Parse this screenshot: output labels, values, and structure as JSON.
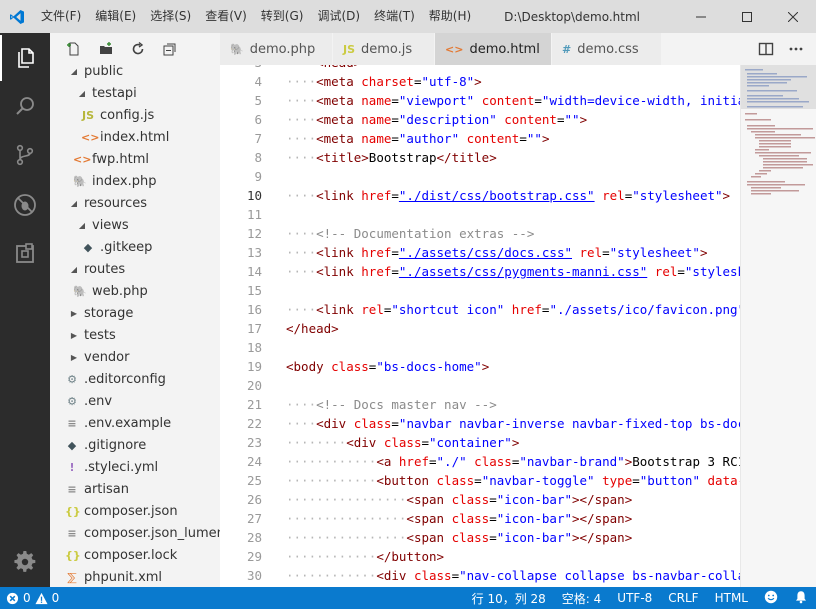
{
  "titlebar": {
    "menu": [
      "文件(F)",
      "编辑(E)",
      "选择(S)",
      "查看(V)",
      "转到(G)",
      "调试(D)",
      "终端(T)",
      "帮助(H)"
    ],
    "title": "D:\\Desktop\\demo.html",
    "logo_color": "#0078d4"
  },
  "sidebar": {
    "tree": [
      {
        "label": "public",
        "type": "folder-open",
        "depth": 1
      },
      {
        "label": "testapi",
        "type": "folder-open",
        "depth": 2
      },
      {
        "label": "config.js",
        "type": "js",
        "depth": 3
      },
      {
        "label": "index.html",
        "type": "html",
        "depth": 3
      },
      {
        "label": "fwp.html",
        "type": "html",
        "depth": 2
      },
      {
        "label": "index.php",
        "type": "php",
        "depth": 2
      },
      {
        "label": "resources",
        "type": "folder-open",
        "depth": 1
      },
      {
        "label": "views",
        "type": "folder-open",
        "depth": 2
      },
      {
        "label": ".gitkeep",
        "type": "git",
        "depth": 3
      },
      {
        "label": "routes",
        "type": "folder-open",
        "depth": 1
      },
      {
        "label": "web.php",
        "type": "php",
        "depth": 2
      },
      {
        "label": "storage",
        "type": "folder-closed",
        "depth": 1
      },
      {
        "label": "tests",
        "type": "folder-closed",
        "depth": 1
      },
      {
        "label": "vendor",
        "type": "folder-closed",
        "depth": 1
      },
      {
        "label": ".editorconfig",
        "type": "gear",
        "depth": 1
      },
      {
        "label": ".env",
        "type": "gear",
        "depth": 1
      },
      {
        "label": ".env.example",
        "type": "text",
        "depth": 1
      },
      {
        "label": ".gitignore",
        "type": "git",
        "depth": 1
      },
      {
        "label": ".styleci.yml",
        "type": "yml",
        "depth": 1
      },
      {
        "label": "artisan",
        "type": "text",
        "depth": 1
      },
      {
        "label": "composer.json",
        "type": "json",
        "depth": 1
      },
      {
        "label": "composer.json_lumen...",
        "type": "text",
        "depth": 1
      },
      {
        "label": "composer.lock",
        "type": "json",
        "depth": 1
      },
      {
        "label": "phpunit.xml",
        "type": "xml",
        "depth": 1
      }
    ]
  },
  "tabs": [
    {
      "label": "demo.php",
      "icon": "php-icon",
      "active": false
    },
    {
      "label": "demo.js",
      "icon": "js-icon",
      "active": false
    },
    {
      "label": "demo.html",
      "icon": "html-icon",
      "active": true
    },
    {
      "label": "demo.css",
      "icon": "css-icon",
      "active": false
    }
  ],
  "editor": {
    "current_line": "10",
    "lines": [
      {
        "n": "3",
        "tokens": [
          [
            "ws",
            "····"
          ],
          [
            "tag",
            "<head>"
          ]
        ]
      },
      {
        "n": "4",
        "tokens": [
          [
            "ws",
            "····"
          ],
          [
            "tag",
            "<meta "
          ],
          [
            "attr",
            "charset"
          ],
          [
            "text",
            "="
          ],
          [
            "str",
            "\"utf-8\""
          ],
          [
            "tag",
            ">"
          ]
        ]
      },
      {
        "n": "5",
        "tokens": [
          [
            "ws",
            "····"
          ],
          [
            "tag",
            "<meta "
          ],
          [
            "attr",
            "name"
          ],
          [
            "text",
            "="
          ],
          [
            "str",
            "\"viewport\""
          ],
          [
            "text",
            " "
          ],
          [
            "attr",
            "content"
          ],
          [
            "text",
            "="
          ],
          [
            "str",
            "\"width=device-width, initial-sc"
          ]
        ]
      },
      {
        "n": "6",
        "tokens": [
          [
            "ws",
            "····"
          ],
          [
            "tag",
            "<meta "
          ],
          [
            "attr",
            "name"
          ],
          [
            "text",
            "="
          ],
          [
            "str",
            "\"description\""
          ],
          [
            "text",
            " "
          ],
          [
            "attr",
            "content"
          ],
          [
            "text",
            "="
          ],
          [
            "str",
            "\"\""
          ],
          [
            "tag",
            ">"
          ]
        ]
      },
      {
        "n": "7",
        "tokens": [
          [
            "ws",
            "····"
          ],
          [
            "tag",
            "<meta "
          ],
          [
            "attr",
            "name"
          ],
          [
            "text",
            "="
          ],
          [
            "str",
            "\"author\""
          ],
          [
            "text",
            " "
          ],
          [
            "attr",
            "content"
          ],
          [
            "text",
            "="
          ],
          [
            "str",
            "\"\""
          ],
          [
            "tag",
            ">"
          ]
        ]
      },
      {
        "n": "8",
        "tokens": [
          [
            "ws",
            "····"
          ],
          [
            "tag",
            "<title>"
          ],
          [
            "text",
            "Bootstrap"
          ],
          [
            "tag",
            "</title>"
          ]
        ]
      },
      {
        "n": "9",
        "tokens": []
      },
      {
        "n": "10",
        "tokens": [
          [
            "ws",
            "····"
          ],
          [
            "tag",
            "<link "
          ],
          [
            "attr",
            "href"
          ],
          [
            "text",
            "="
          ],
          [
            "link",
            "\"./dist/css/bootstrap.css\""
          ],
          [
            "text",
            " "
          ],
          [
            "attr",
            "rel"
          ],
          [
            "text",
            "="
          ],
          [
            "str",
            "\"stylesheet\""
          ],
          [
            "tag",
            ">"
          ]
        ]
      },
      {
        "n": "11",
        "tokens": []
      },
      {
        "n": "12",
        "tokens": [
          [
            "ws",
            "····"
          ],
          [
            "cmt",
            "<!-- Documentation extras -->"
          ]
        ]
      },
      {
        "n": "13",
        "tokens": [
          [
            "ws",
            "····"
          ],
          [
            "tag",
            "<link "
          ],
          [
            "attr",
            "href"
          ],
          [
            "text",
            "="
          ],
          [
            "link",
            "\"./assets/css/docs.css\""
          ],
          [
            "text",
            " "
          ],
          [
            "attr",
            "rel"
          ],
          [
            "text",
            "="
          ],
          [
            "str",
            "\"stylesheet\""
          ],
          [
            "tag",
            ">"
          ]
        ]
      },
      {
        "n": "14",
        "tokens": [
          [
            "ws",
            "····"
          ],
          [
            "tag",
            "<link "
          ],
          [
            "attr",
            "href"
          ],
          [
            "text",
            "="
          ],
          [
            "link",
            "\"./assets/css/pygments-manni.css\""
          ],
          [
            "text",
            " "
          ],
          [
            "attr",
            "rel"
          ],
          [
            "text",
            "="
          ],
          [
            "str",
            "\"stylesheet\""
          ]
        ]
      },
      {
        "n": "15",
        "tokens": []
      },
      {
        "n": "16",
        "tokens": [
          [
            "ws",
            "····"
          ],
          [
            "tag",
            "<link "
          ],
          [
            "attr",
            "rel"
          ],
          [
            "text",
            "="
          ],
          [
            "str",
            "\"shortcut icon\""
          ],
          [
            "text",
            " "
          ],
          [
            "attr",
            "href"
          ],
          [
            "text",
            "="
          ],
          [
            "str",
            "\"./assets/ico/favicon.png\""
          ],
          [
            "tag",
            ">"
          ]
        ]
      },
      {
        "n": "17",
        "tokens": [
          [
            "tag",
            "</head>"
          ]
        ]
      },
      {
        "n": "18",
        "tokens": []
      },
      {
        "n": "19",
        "tokens": [
          [
            "tag",
            "<body "
          ],
          [
            "attr",
            "class"
          ],
          [
            "text",
            "="
          ],
          [
            "str",
            "\"bs-docs-home\""
          ],
          [
            "tag",
            ">"
          ]
        ]
      },
      {
        "n": "20",
        "tokens": []
      },
      {
        "n": "21",
        "tokens": [
          [
            "ws",
            "····"
          ],
          [
            "cmt",
            "<!-- Docs master nav -->"
          ]
        ]
      },
      {
        "n": "22",
        "tokens": [
          [
            "ws",
            "····"
          ],
          [
            "tag",
            "<div "
          ],
          [
            "attr",
            "class"
          ],
          [
            "text",
            "="
          ],
          [
            "str",
            "\"navbar navbar-inverse navbar-fixed-top bs-docs-na"
          ]
        ]
      },
      {
        "n": "23",
        "tokens": [
          [
            "ws",
            "········"
          ],
          [
            "tag",
            "<div "
          ],
          [
            "attr",
            "class"
          ],
          [
            "text",
            "="
          ],
          [
            "str",
            "\"container\""
          ],
          [
            "tag",
            ">"
          ]
        ]
      },
      {
        "n": "24",
        "tokens": [
          [
            "ws",
            "············"
          ],
          [
            "tag",
            "<a "
          ],
          [
            "attr",
            "href"
          ],
          [
            "text",
            "="
          ],
          [
            "str",
            "\"./\""
          ],
          [
            "text",
            " "
          ],
          [
            "attr",
            "class"
          ],
          [
            "text",
            "="
          ],
          [
            "str",
            "\"navbar-brand\""
          ],
          [
            "tag",
            ">"
          ],
          [
            "text",
            "Bootstrap 3 RC1"
          ],
          [
            "tag",
            "</a>"
          ]
        ]
      },
      {
        "n": "25",
        "tokens": [
          [
            "ws",
            "············"
          ],
          [
            "tag",
            "<button "
          ],
          [
            "attr",
            "class"
          ],
          [
            "text",
            "="
          ],
          [
            "str",
            "\"navbar-toggle\""
          ],
          [
            "text",
            " "
          ],
          [
            "attr",
            "type"
          ],
          [
            "text",
            "="
          ],
          [
            "str",
            "\"button\""
          ],
          [
            "text",
            " "
          ],
          [
            "attr",
            "data-togg"
          ]
        ]
      },
      {
        "n": "26",
        "tokens": [
          [
            "ws",
            "················"
          ],
          [
            "tag",
            "<span "
          ],
          [
            "attr",
            "class"
          ],
          [
            "text",
            "="
          ],
          [
            "str",
            "\"icon-bar\""
          ],
          [
            "tag",
            "></span>"
          ]
        ]
      },
      {
        "n": "27",
        "tokens": [
          [
            "ws",
            "················"
          ],
          [
            "tag",
            "<span "
          ],
          [
            "attr",
            "class"
          ],
          [
            "text",
            "="
          ],
          [
            "str",
            "\"icon-bar\""
          ],
          [
            "tag",
            "></span>"
          ]
        ]
      },
      {
        "n": "28",
        "tokens": [
          [
            "ws",
            "················"
          ],
          [
            "tag",
            "<span "
          ],
          [
            "attr",
            "class"
          ],
          [
            "text",
            "="
          ],
          [
            "str",
            "\"icon-bar\""
          ],
          [
            "tag",
            "></span>"
          ]
        ]
      },
      {
        "n": "29",
        "tokens": [
          [
            "ws",
            "············"
          ],
          [
            "tag",
            "</button>"
          ]
        ]
      },
      {
        "n": "30",
        "tokens": [
          [
            "ws",
            "············"
          ],
          [
            "tag",
            "<div "
          ],
          [
            "attr",
            "class"
          ],
          [
            "text",
            "="
          ],
          [
            "str",
            "\"nav-collapse collapse bs-navbar-collapse\""
          ]
        ]
      }
    ]
  },
  "statusbar": {
    "errors": "0",
    "warnings": "0",
    "position": "行 10，列 28",
    "spaces": "空格: 4",
    "encoding": "UTF-8",
    "eol": "CRLF",
    "language": "HTML",
    "color": "#0a7ace"
  }
}
